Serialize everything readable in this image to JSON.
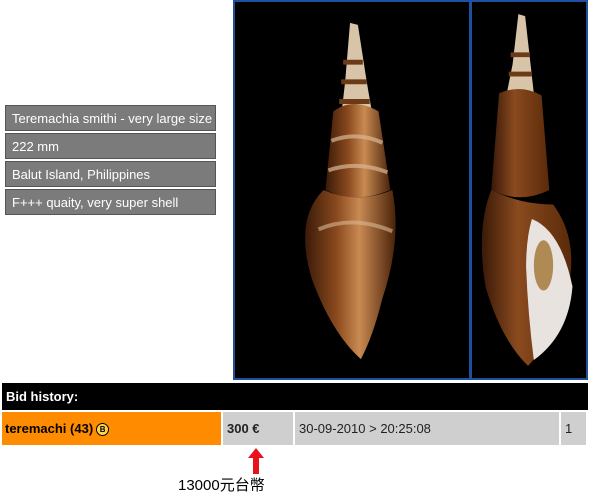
{
  "info_rows": [
    "Teremachia smithi - very large size",
    "222 mm",
    "Balut Island, Philippines",
    "F+++ quaity, very super shell"
  ],
  "bid_history": {
    "title": "Bid history:",
    "rows": [
      {
        "bidder": "teremachi (43)",
        "badge": "B",
        "price": "300 €",
        "datetime": "30-09-2010 > 20:25:08",
        "count": "1"
      }
    ]
  },
  "annotation": "13000元台幣",
  "colors": {
    "accent_orange": "#ff8c00",
    "arrow_red": "#e8121c",
    "photo_border": "#1f4f9e"
  },
  "icons": [
    "red-arrow-icon",
    "bidder-badge-icon"
  ]
}
